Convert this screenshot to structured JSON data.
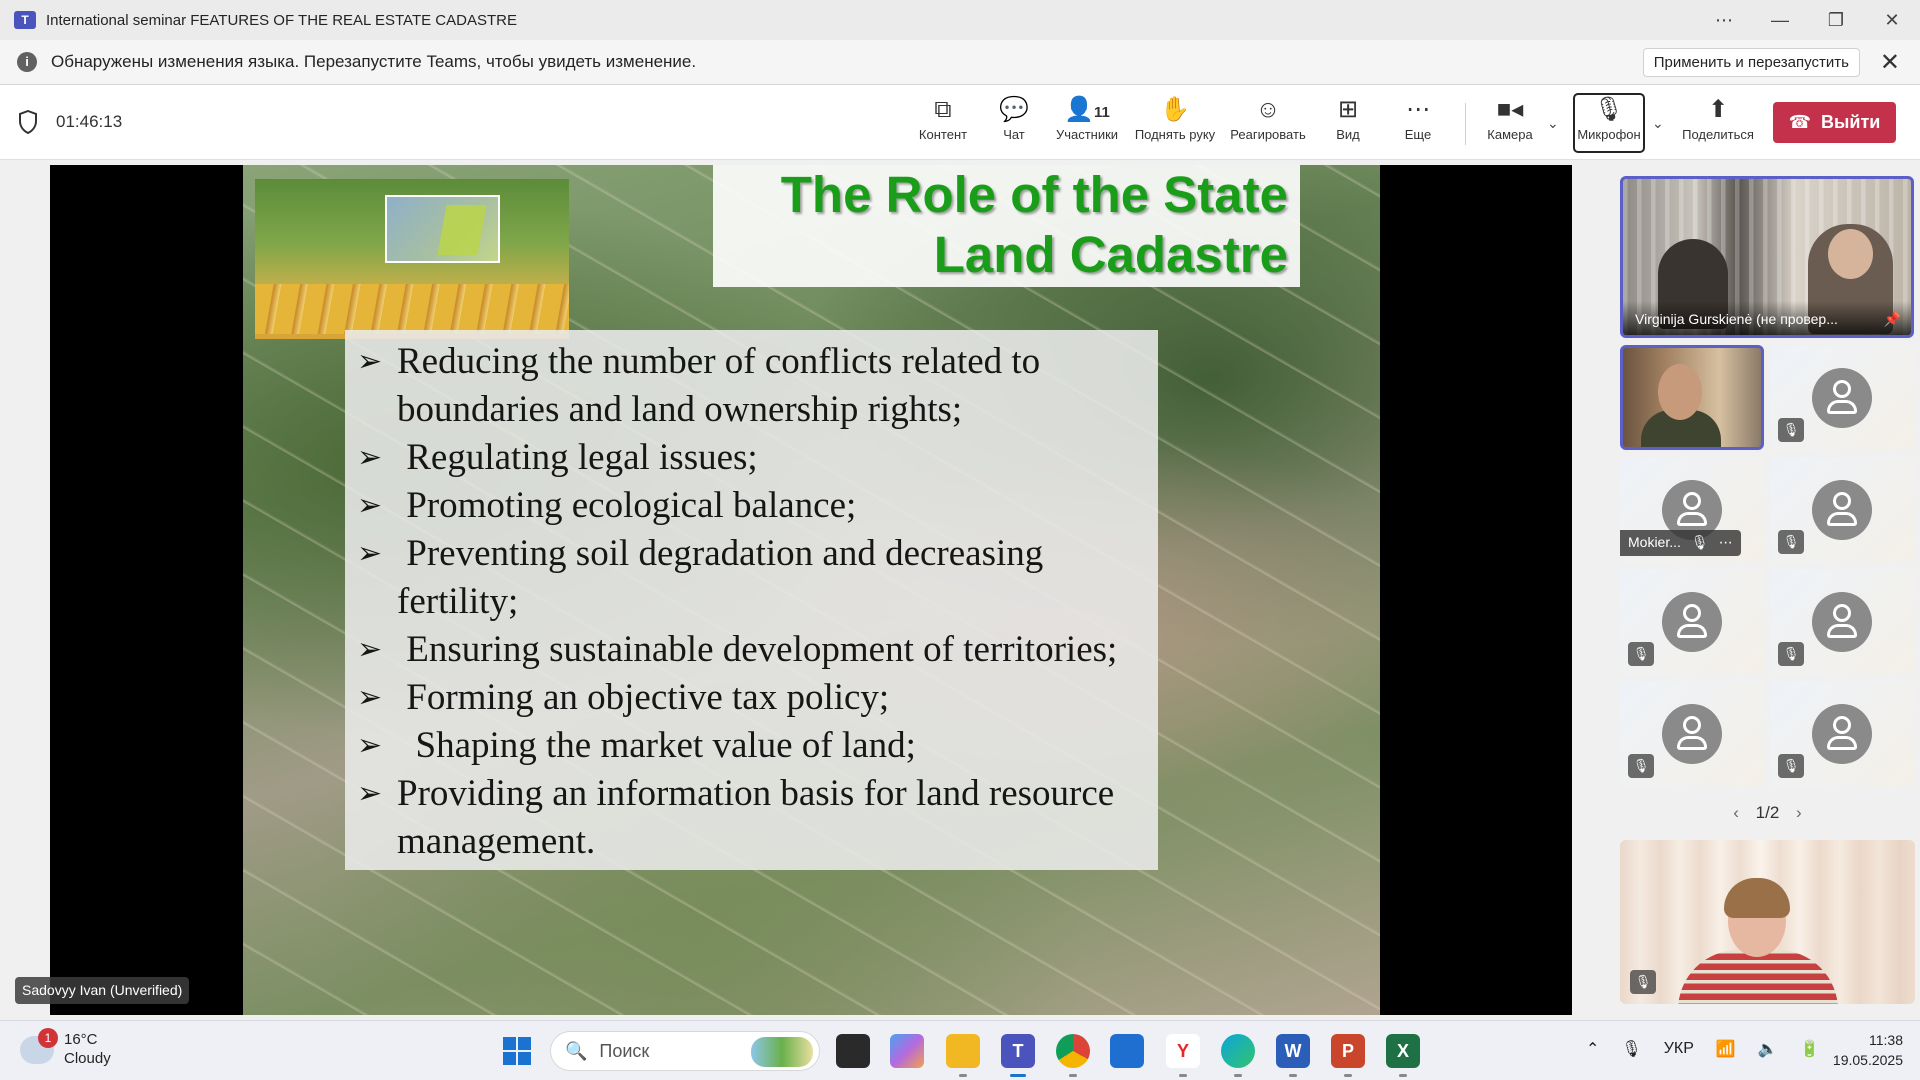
{
  "window": {
    "title": "International seminar FEATURES OF THE REAL ESTATE CADASTRE",
    "app_icon": "teams-icon",
    "controls": [
      "more-icon",
      "minimize-icon",
      "restore-icon",
      "close-icon"
    ]
  },
  "infobar": {
    "message": "Обнаружены изменения языка. Перезапустите Teams, чтобы увидеть изменение.",
    "apply_button": "Применить и перезапустить"
  },
  "meeting": {
    "timer": "01:46:13",
    "toolbar": {
      "content": "Контент",
      "chat": "Чат",
      "participants": "Участники",
      "participants_count": "11",
      "raise_hand": "Поднять руку",
      "react": "Реагировать",
      "view": "Вид",
      "more": "Еще",
      "camera": "Камера",
      "mic": "Микрофон",
      "share": "Поделиться",
      "leave": "Выйти"
    }
  },
  "slide": {
    "title_line1": "The Role of the State",
    "title_line2": "Land Cadastre",
    "title_color": "#1a9e1a",
    "bullets": [
      "Reducing the number of conflicts related to boundaries and land ownership rights;",
      " Regulating legal issues;",
      " Promoting ecological balance;",
      " Preventing soil degradation and decreasing fertility;",
      " Ensuring sustainable development of territories;",
      " Forming an objective tax policy;",
      "  Shaping the market value of land;",
      "Providing an information basis for land resource management."
    ]
  },
  "stage": {
    "presenter_name": "Sadovyy Ivan (Unverified)"
  },
  "participants_panel": {
    "pinned_name": "Virginija Gurskienė (не провер...",
    "tile_name": "Mokier...",
    "pager": "1/2"
  },
  "taskbar": {
    "temperature": "16°C",
    "weather": "Cloudy",
    "weather_badge": "1",
    "search_placeholder": "Поиск",
    "language": "УКР",
    "time": "11:38",
    "date": "19.05.2025"
  },
  "colors": {
    "accent": "#5b5fc7",
    "leave": "#c4314b"
  }
}
